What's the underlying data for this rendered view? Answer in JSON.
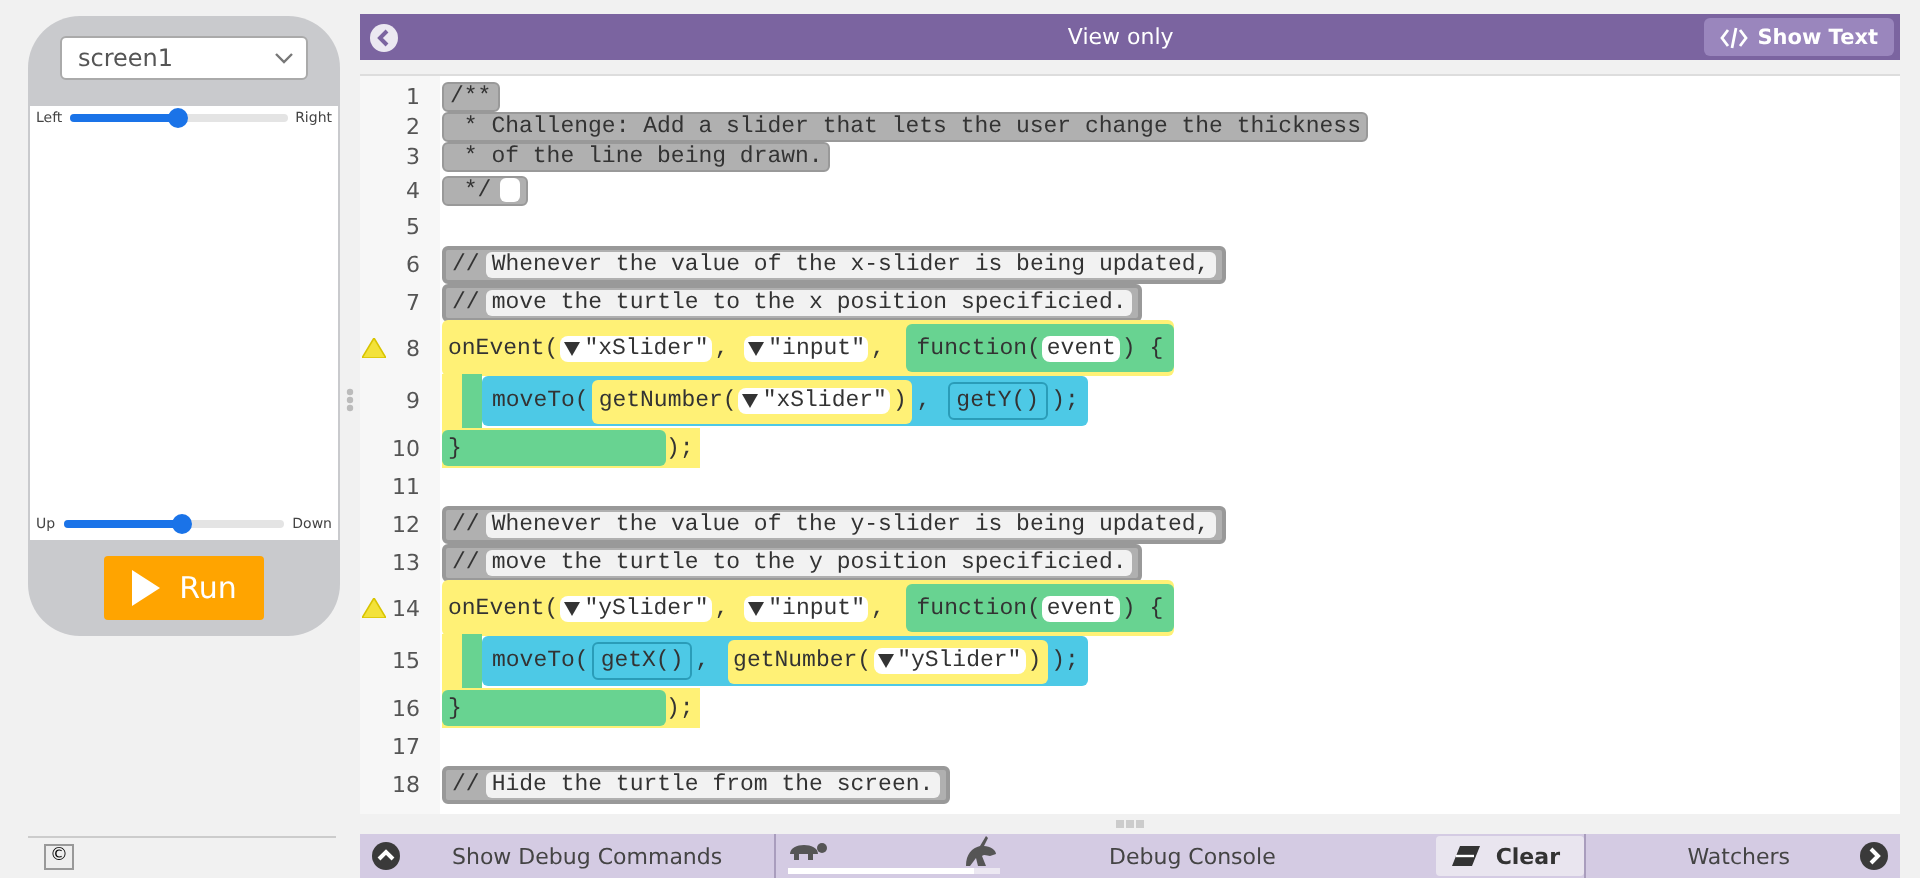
{
  "app_preview": {
    "screen_dropdown": {
      "value": "screen1"
    },
    "sliders": [
      {
        "min_label": "Left",
        "max_label": "Right",
        "level": 0.5
      },
      {
        "min_label": "Up",
        "max_label": "Down",
        "level": 0.54
      }
    ],
    "run_button": {
      "label": "Run"
    }
  },
  "footer": {
    "copyright": "©"
  },
  "editor": {
    "title": "View only",
    "show_text_button": {
      "label": "Show Text"
    },
    "lines": [
      {
        "number": "1",
        "warning": false,
        "kind": "doc-comment",
        "parts": [
          {
            "kind": "comment-block",
            "parts": [
              {
                "kind": "text",
                "text": "/**"
              }
            ]
          }
        ]
      },
      {
        "number": "2",
        "warning": false,
        "kind": "doc-comment",
        "parts": [
          {
            "kind": "comment-block",
            "parts": [
              {
                "kind": "text",
                "text": " * Challenge: Add a slider that lets the user change the thickness"
              }
            ]
          }
        ]
      },
      {
        "number": "3",
        "warning": false,
        "kind": "doc-comment",
        "parts": [
          {
            "kind": "comment-block",
            "parts": [
              {
                "kind": "text",
                "text": " * of the line being drawn."
              }
            ]
          }
        ]
      },
      {
        "number": "4",
        "warning": false,
        "kind": "doc-comment-end",
        "parts": [
          {
            "kind": "comment-block",
            "parts": [
              {
                "kind": "text",
                "text": " */"
              },
              {
                "kind": "slot"
              }
            ]
          }
        ]
      },
      {
        "number": "5",
        "warning": false,
        "kind": "blank"
      },
      {
        "number": "6",
        "warning": false,
        "kind": "comment",
        "parts": [
          {
            "kind": "comment-block",
            "parts": [
              {
                "kind": "text",
                "text": "//"
              },
              {
                "kind": "field",
                "text": "Whenever the value of the x-slider is being updated,"
              }
            ]
          }
        ]
      },
      {
        "number": "7",
        "warning": false,
        "kind": "comment",
        "parts": [
          {
            "kind": "comment-block",
            "parts": [
              {
                "kind": "text",
                "text": "//"
              },
              {
                "kind": "field",
                "text": "move the turtle to the x position specificied."
              }
            ]
          }
        ]
      },
      {
        "number": "8",
        "warning": true,
        "kind": "event-head",
        "parts": [
          {
            "kind": "event-block",
            "parts": [
              {
                "kind": "text",
                "text": "onEvent("
              },
              {
                "kind": "dropdown",
                "text": "\"xSlider\""
              },
              {
                "kind": "text",
                "text": ", "
              },
              {
                "kind": "dropdown",
                "text": "\"input\""
              },
              {
                "kind": "text",
                "text": ", "
              },
              {
                "kind": "function-block",
                "parts": [
                  {
                    "kind": "text",
                    "text": "function("
                  },
                  {
                    "kind": "param",
                    "text": "event"
                  },
                  {
                    "kind": "text",
                    "text": ") {"
                  }
                ]
              }
            ]
          }
        ]
      },
      {
        "number": "9",
        "warning": false,
        "kind": "event-body",
        "parts": [
          {
            "kind": "call-block",
            "parts": [
              {
                "kind": "text",
                "text": "moveTo("
              },
              {
                "kind": "getter-block",
                "parts": [
                  {
                    "kind": "text",
                    "text": "getNumber("
                  },
                  {
                    "kind": "dropdown",
                    "text": "\"xSlider\""
                  },
                  {
                    "kind": "text",
                    "text": ")"
                  }
                ]
              },
              {
                "kind": "text",
                "text": ", "
              },
              {
                "kind": "inner-call-block",
                "parts": [
                  {
                    "kind": "text",
                    "text": "getY()"
                  }
                ]
              },
              {
                "kind": "text",
                "text": ");"
              }
            ]
          }
        ]
      },
      {
        "number": "10",
        "warning": false,
        "kind": "event-close",
        "parts": [
          {
            "kind": "function-end-block",
            "parts": [
              {
                "kind": "text",
                "text": "}"
              }
            ]
          },
          {
            "kind": "text",
            "text": ");"
          }
        ]
      },
      {
        "number": "11",
        "warning": false,
        "kind": "blank"
      },
      {
        "number": "12",
        "warning": false,
        "kind": "comment",
        "parts": [
          {
            "kind": "comment-block",
            "parts": [
              {
                "kind": "text",
                "text": "//"
              },
              {
                "kind": "field",
                "text": "Whenever the value of the y-slider is being updated,"
              }
            ]
          }
        ]
      },
      {
        "number": "13",
        "warning": false,
        "kind": "comment",
        "parts": [
          {
            "kind": "comment-block",
            "parts": [
              {
                "kind": "text",
                "text": "//"
              },
              {
                "kind": "field",
                "text": "move the turtle to the y position specificied."
              }
            ]
          }
        ]
      },
      {
        "number": "14",
        "warning": true,
        "kind": "event-head",
        "parts": [
          {
            "kind": "event-block",
            "parts": [
              {
                "kind": "text",
                "text": "onEvent("
              },
              {
                "kind": "dropdown",
                "text": "\"ySlider\""
              },
              {
                "kind": "text",
                "text": ", "
              },
              {
                "kind": "dropdown",
                "text": "\"input\""
              },
              {
                "kind": "text",
                "text": ", "
              },
              {
                "kind": "function-block",
                "parts": [
                  {
                    "kind": "text",
                    "text": "function("
                  },
                  {
                    "kind": "param",
                    "text": "event"
                  },
                  {
                    "kind": "text",
                    "text": ") {"
                  }
                ]
              }
            ]
          }
        ]
      },
      {
        "number": "15",
        "warning": false,
        "kind": "event-body",
        "parts": [
          {
            "kind": "call-block",
            "parts": [
              {
                "kind": "text",
                "text": "moveTo("
              },
              {
                "kind": "inner-call-block",
                "parts": [
                  {
                    "kind": "text",
                    "text": "getX()"
                  }
                ]
              },
              {
                "kind": "text",
                "text": ", "
              },
              {
                "kind": "getter-block",
                "parts": [
                  {
                    "kind": "text",
                    "text": "getNumber("
                  },
                  {
                    "kind": "dropdown",
                    "text": "\"ySlider\""
                  },
                  {
                    "kind": "text",
                    "text": ")"
                  }
                ]
              },
              {
                "kind": "text",
                "text": ");"
              }
            ]
          }
        ]
      },
      {
        "number": "16",
        "warning": false,
        "kind": "event-close",
        "parts": [
          {
            "kind": "function-end-block",
            "parts": [
              {
                "kind": "text",
                "text": "}"
              }
            ]
          },
          {
            "kind": "text",
            "text": ");"
          }
        ]
      },
      {
        "number": "17",
        "warning": false,
        "kind": "blank"
      },
      {
        "number": "18",
        "warning": false,
        "kind": "comment",
        "parts": [
          {
            "kind": "comment-block",
            "parts": [
              {
                "kind": "text",
                "text": "//"
              },
              {
                "kind": "field",
                "text": "Hide the turtle from the screen."
              }
            ]
          }
        ]
      }
    ]
  },
  "debug_bar": {
    "show_debug_commands": {
      "label": "Show Debug Commands"
    },
    "speed_slider": {
      "level": 0.88
    },
    "console_title": "Debug Console",
    "clear_button": {
      "label": "Clear"
    },
    "watchers_title": "Watchers"
  }
}
